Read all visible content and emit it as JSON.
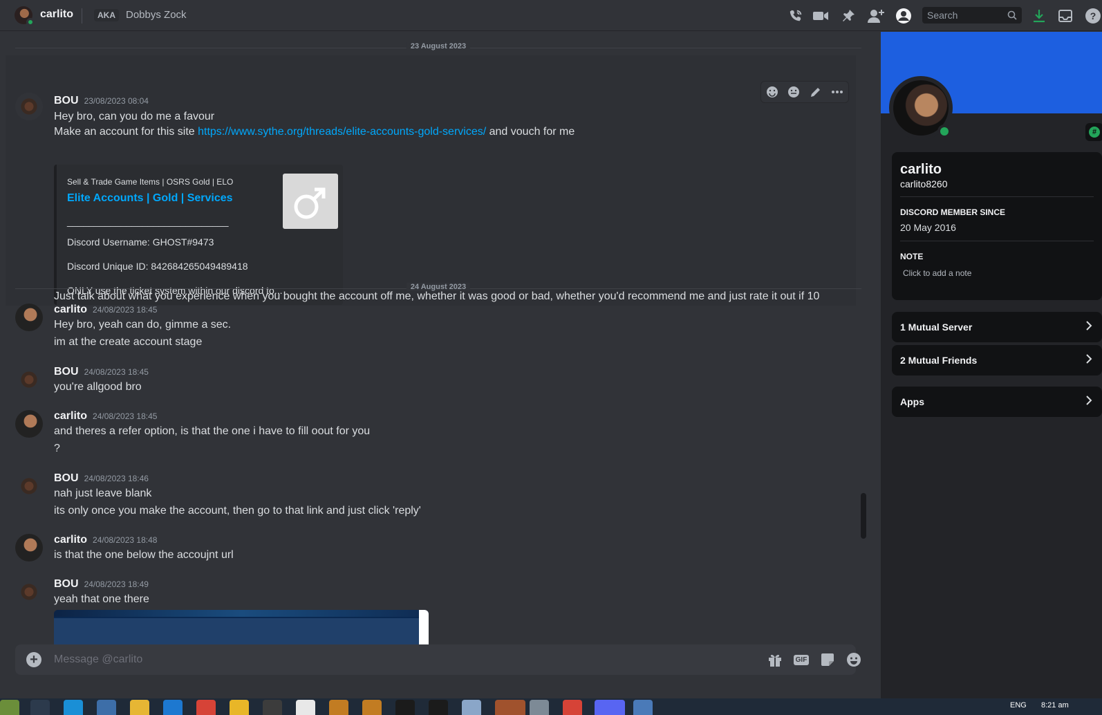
{
  "header": {
    "name": "carlito",
    "aka": "AKA",
    "nickname": "Dobbys Zock",
    "search_placeholder": "Search"
  },
  "dates": [
    "23 August 2023",
    "24 August 2023"
  ],
  "first_message": {
    "author": "BOU",
    "timestamp": "23/08/2023 08:04",
    "line1": "Hey bro, can you do me a favour",
    "line2_prefix": "Make an account for this site ",
    "line2_link": "https://www.sythe.org/threads/elite-accounts-gold-services/",
    "line2_suffix": " and vouch for me",
    "embed": {
      "provider": "Sell & Trade Game Items | OSRS Gold | ELO",
      "title": "Elite Accounts | Gold | Services",
      "divider": "______________________________",
      "d1": "Discord Username: GHOST#9473",
      "d2": "Discord Unique ID: 842684265049489418",
      "d3": "ONLY use the ticket system within our discord to..."
    },
    "line3": "Just talk about what you experience when you bought the account off me, whether it was good or bad, whether you'd recommend me and just rate it out if 10"
  },
  "messages": [
    {
      "author": "carlito",
      "timestamp": "24/08/2023 18:45",
      "lines": [
        "Hey bro, yeah can do, gimme a sec.",
        "im at the create account stage"
      ]
    },
    {
      "author": "BOU",
      "timestamp": "24/08/2023 18:45",
      "lines": [
        "you're allgood bro"
      ]
    },
    {
      "author": "carlito",
      "timestamp": "24/08/2023 18:45",
      "lines": [
        "and theres a refer option, is that the one i have to fill oout for you",
        "?"
      ]
    },
    {
      "author": "BOU",
      "timestamp": "24/08/2023 18:46",
      "lines": [
        "nah just leave blank",
        "its only once you make the account, then go to that link and just click 'reply'"
      ]
    },
    {
      "author": "carlito",
      "timestamp": "24/08/2023 18:48",
      "lines": [
        "is that the one below the accoujnt url"
      ]
    },
    {
      "author": "BOU",
      "timestamp": "24/08/2023 18:49",
      "lines": [
        "yeah that one there"
      ]
    }
  ],
  "composer": {
    "placeholder": "Message @carlito",
    "gif": "GIF"
  },
  "profile": {
    "display_name": "carlito",
    "username": "carlito8260",
    "member_since_label": "DISCORD MEMBER SINCE",
    "member_since": "20 May 2016",
    "note_label": "NOTE",
    "note_placeholder": "Click to add a note",
    "mutual_servers": "1 Mutual Server",
    "mutual_friends": "2 Mutual Friends",
    "apps": "Apps"
  },
  "taskbar": {
    "time": "8:21 am",
    "lang": "ENG"
  },
  "colors": {
    "background": "#313338",
    "panel": "#232428",
    "banner": "#1d5fe0",
    "link": "#00a8fc",
    "online": "#23a55a"
  }
}
